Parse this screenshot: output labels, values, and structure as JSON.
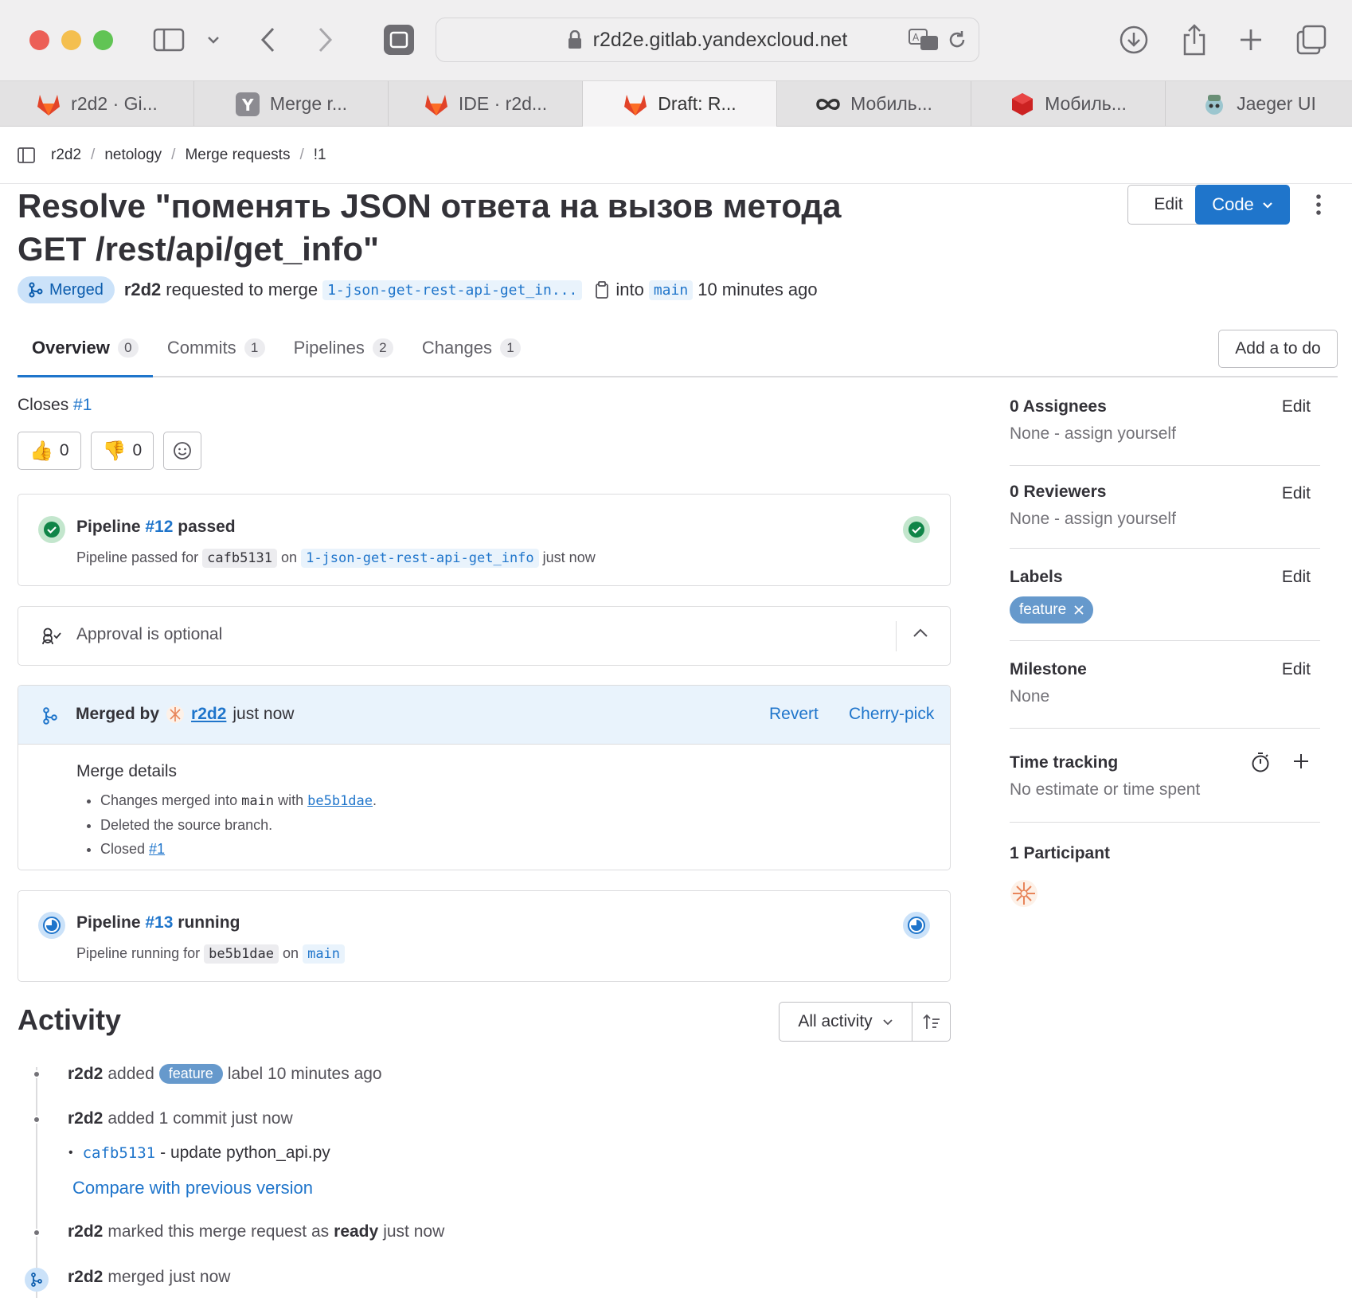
{
  "browser": {
    "url": "r2d2e.gitlab.yandexcloud.net",
    "tabs": [
      {
        "label": "r2d2 · Gi...",
        "icon": "gitlab-icon",
        "active": false
      },
      {
        "label": "Merge r...",
        "icon": "yandex-icon",
        "active": false
      },
      {
        "label": "IDE · r2d...",
        "icon": "gitlab-icon",
        "active": false
      },
      {
        "label": "Draft: R...",
        "icon": "gitlab-icon",
        "active": true
      },
      {
        "label": "Мобиль...",
        "icon": "infinity-icon",
        "active": false
      },
      {
        "label": "Мобиль...",
        "icon": "ruby-icon",
        "active": false
      },
      {
        "label": "Jaeger UI",
        "icon": "jaeger-icon",
        "active": false
      }
    ]
  },
  "breadcrumb": [
    "r2d2",
    "netology",
    "Merge requests",
    "!1"
  ],
  "mr": {
    "title": "Resolve \"поменять JSON ответа на вызов метода GET /rest/api/get_info\"",
    "edit_label": "Edit",
    "code_label": "Code",
    "status": "Merged",
    "author": "r2d2",
    "requested_text": "requested to merge",
    "source_branch": "1-json-get-rest-api-get_in...",
    "into_text": "into",
    "target_branch": "main",
    "time_ago": "10 minutes ago"
  },
  "tabs": [
    {
      "label": "Overview",
      "count": "0",
      "active": true
    },
    {
      "label": "Commits",
      "count": "1",
      "active": false
    },
    {
      "label": "Pipelines",
      "count": "2",
      "active": false
    },
    {
      "label": "Changes",
      "count": "1",
      "active": false
    }
  ],
  "todo_label": "Add a to do",
  "closes": {
    "text": "Closes",
    "issue": "#1"
  },
  "reactions": {
    "thumbs_up": "0",
    "thumbs_down": "0"
  },
  "pipeline1": {
    "prefix": "Pipeline",
    "id": "#12",
    "status": "passed",
    "detail_prefix": "Pipeline passed for",
    "commit": "cafb5131",
    "on": "on",
    "branch": "1-json-get-rest-api-get_info",
    "time": "just now"
  },
  "approval": {
    "text": "Approval is optional"
  },
  "merged": {
    "by_label": "Merged by",
    "user": "r2d2",
    "time": "just now",
    "revert": "Revert",
    "cherry_pick": "Cherry-pick",
    "details_title": "Merge details",
    "item1_prefix": "Changes merged into",
    "item1_branch": "main",
    "item1_with": "with",
    "item1_commit": "be5b1dae",
    "item2": "Deleted the source branch.",
    "item3_prefix": "Closed",
    "item3_issue": "#1"
  },
  "pipeline2": {
    "prefix": "Pipeline",
    "id": "#13",
    "status": "running",
    "detail_prefix": "Pipeline running for",
    "commit": "be5b1dae",
    "on": "on",
    "branch": "main"
  },
  "activity": {
    "title": "Activity",
    "filter": "All activity",
    "items": [
      {
        "user": "r2d2",
        "pre": "added",
        "label": "feature",
        "post": "label 10 minutes ago"
      },
      {
        "user": "r2d2",
        "text": "added 1 commit just now"
      },
      {
        "commit": "cafb5131",
        "message": "- update python_api.py"
      },
      {
        "link": "Compare with previous version"
      },
      {
        "user": "r2d2",
        "pre": "marked this merge request as",
        "strong": "ready",
        "post": "just now"
      },
      {
        "user": "r2d2",
        "text": "merged just now"
      }
    ]
  },
  "sidebar": {
    "assignees": {
      "title": "0 Assignees",
      "edit": "Edit",
      "value": "None - assign yourself"
    },
    "reviewers": {
      "title": "0 Reviewers",
      "edit": "Edit",
      "value": "None - assign yourself"
    },
    "labels": {
      "title": "Labels",
      "edit": "Edit",
      "label": "feature"
    },
    "milestone": {
      "title": "Milestone",
      "edit": "Edit",
      "value": "None"
    },
    "time_tracking": {
      "title": "Time tracking",
      "value": "No estimate or time spent"
    },
    "participants": {
      "title": "1 Participant"
    }
  },
  "colors": {
    "accent": "#1f75cb",
    "merged_bg": "#cbe2f9",
    "success": "#108548",
    "label": "#6699cc"
  }
}
